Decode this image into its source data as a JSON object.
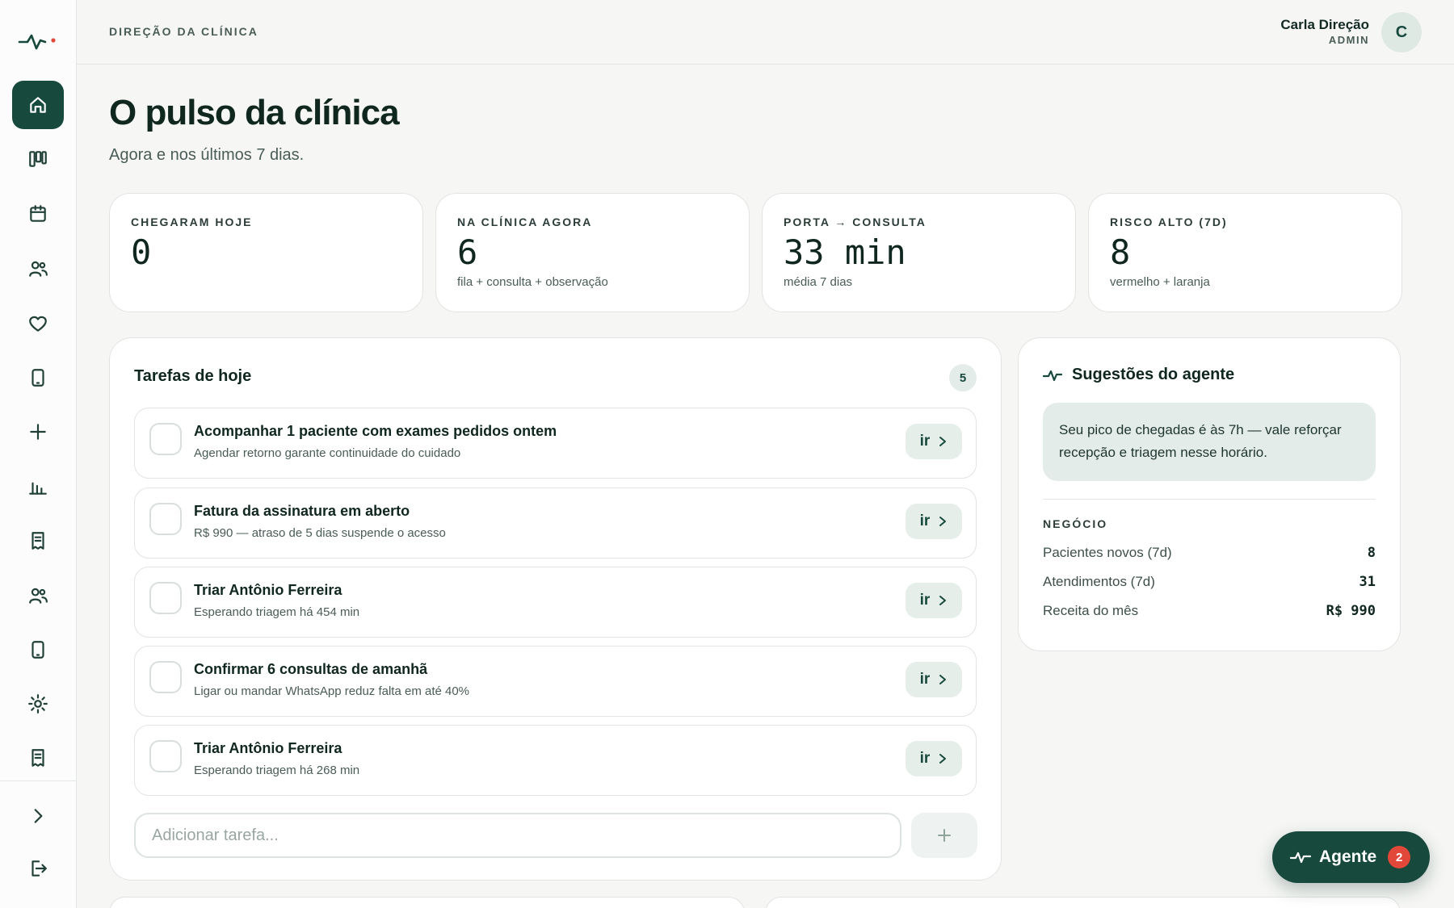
{
  "header": {
    "breadcrumb": "DIREÇÃO DA CLÍNICA",
    "user_name": "Carla Direção",
    "user_role": "ADMIN",
    "avatar_initial": "C"
  },
  "page": {
    "title": "O pulso da clínica",
    "subtitle": "Agora e nos últimos 7 dias."
  },
  "sidebar": {
    "items": [
      {
        "icon": "home-icon",
        "active": true
      },
      {
        "icon": "kanban-icon"
      },
      {
        "icon": "calendar-icon"
      },
      {
        "icon": "users-icon"
      },
      {
        "icon": "heart-icon"
      },
      {
        "icon": "tablet-icon"
      },
      {
        "icon": "plus-icon"
      },
      {
        "icon": "bar-chart-icon"
      },
      {
        "icon": "receipt-icon"
      },
      {
        "icon": "team-icon"
      },
      {
        "icon": "tablet-icon"
      },
      {
        "icon": "gear-icon"
      },
      {
        "icon": "receipt-icon"
      }
    ],
    "footer": [
      {
        "icon": "chevron-right-icon"
      },
      {
        "icon": "logout-icon"
      }
    ]
  },
  "stats": [
    {
      "label": "CHEGARAM HOJE",
      "value": "0",
      "note": ""
    },
    {
      "label": "NA CLÍNICA AGORA",
      "value": "6",
      "note": "fila + consulta + observação"
    },
    {
      "label": "PORTA → CONSULTA",
      "value": "33 min",
      "note": "média 7 dias"
    },
    {
      "label": "RISCO ALTO (7D)",
      "value": "8",
      "note": "vermelho + laranja"
    }
  ],
  "tasks": {
    "title": "Tarefas de hoje",
    "count": "5",
    "go_label": "ir",
    "items": [
      {
        "title": "Acompanhar 1 paciente com exames pedidos ontem",
        "subtitle": "Agendar retorno garante continuidade do cuidado"
      },
      {
        "title": "Fatura da assinatura em aberto",
        "subtitle": "R$ 990 — atraso de 5 dias suspende o acesso"
      },
      {
        "title": "Triar Antônio Ferreira",
        "subtitle": "Esperando triagem há 454 min"
      },
      {
        "title": "Confirmar 6 consultas de amanhã",
        "subtitle": "Ligar ou mandar WhatsApp reduz falta em até 40%"
      },
      {
        "title": "Triar Antônio Ferreira",
        "subtitle": "Esperando triagem há 268 min"
      }
    ],
    "add_placeholder": "Adicionar tarefa..."
  },
  "agent": {
    "title": "Sugestões do agente",
    "suggestion": "Seu pico de chegadas é às 7h — vale reforçar recepção e triagem nesse horário.",
    "business_label": "NEGÓCIO",
    "business": [
      {
        "label": "Pacientes novos (7d)",
        "value": "8"
      },
      {
        "label": "Atendimentos (7d)",
        "value": "31"
      },
      {
        "label": "Receita do mês",
        "value": "R$ 990"
      }
    ]
  },
  "fab": {
    "label": "Agente",
    "badge": "2"
  },
  "colors": {
    "brand": "#17493d",
    "accent_soft": "#e3ece8",
    "alert": "#e1483a",
    "background": "#f6f7f5"
  }
}
